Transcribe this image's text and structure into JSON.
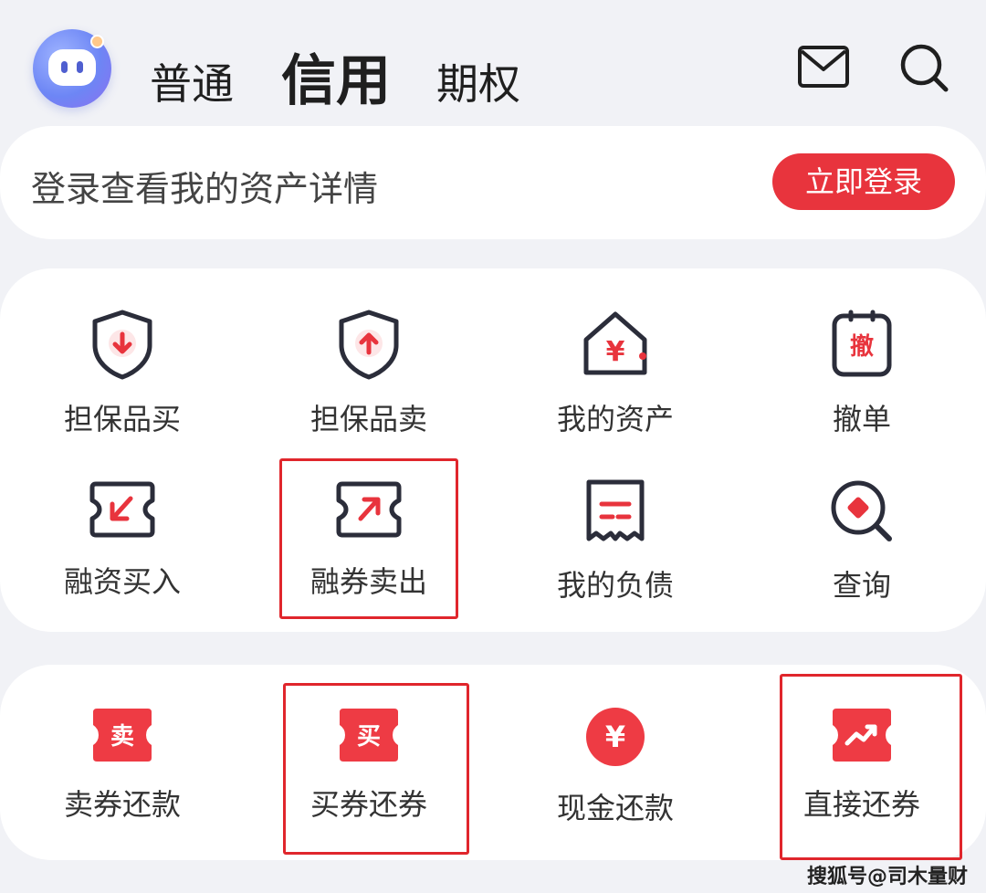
{
  "header": {
    "tabs": [
      {
        "label": "普通",
        "active": false
      },
      {
        "label": "信用",
        "active": true
      },
      {
        "label": "期权",
        "active": false
      }
    ],
    "icons": [
      "mail-icon",
      "search-icon"
    ]
  },
  "login": {
    "prompt": "登录查看我的资产详情",
    "button_label": "立即登录"
  },
  "grid1": {
    "items": [
      {
        "label": "担保品买",
        "icon": "shield-down-icon"
      },
      {
        "label": "担保品卖",
        "icon": "shield-up-icon"
      },
      {
        "label": "我的资产",
        "icon": "house-yen-icon"
      },
      {
        "label": "撤单",
        "icon": "cancel-order-icon"
      },
      {
        "label": "融资买入",
        "icon": "ticket-arrow-in-icon"
      },
      {
        "label": "融券卖出",
        "icon": "ticket-arrow-out-icon"
      },
      {
        "label": "我的负债",
        "icon": "receipt-icon"
      },
      {
        "label": "查询",
        "icon": "query-magnifier-icon"
      }
    ]
  },
  "grid2": {
    "items": [
      {
        "label": "卖券还款",
        "icon": "sell-ticket-icon",
        "glyph": "卖"
      },
      {
        "label": "买券还券",
        "icon": "buy-ticket-icon",
        "glyph": "买"
      },
      {
        "label": "现金还款",
        "icon": "cash-yen-icon",
        "glyph": "¥"
      },
      {
        "label": "直接还券",
        "icon": "direct-return-icon"
      }
    ]
  },
  "icon_glyphs": {
    "cancel": "撤",
    "yen": "¥"
  },
  "colors": {
    "accent": "#e8343d",
    "outline": "#2b2d3a",
    "highlight_box": "#e0262c",
    "background": "#f1f2f6"
  },
  "watermark": "搜狐号@司木量财"
}
